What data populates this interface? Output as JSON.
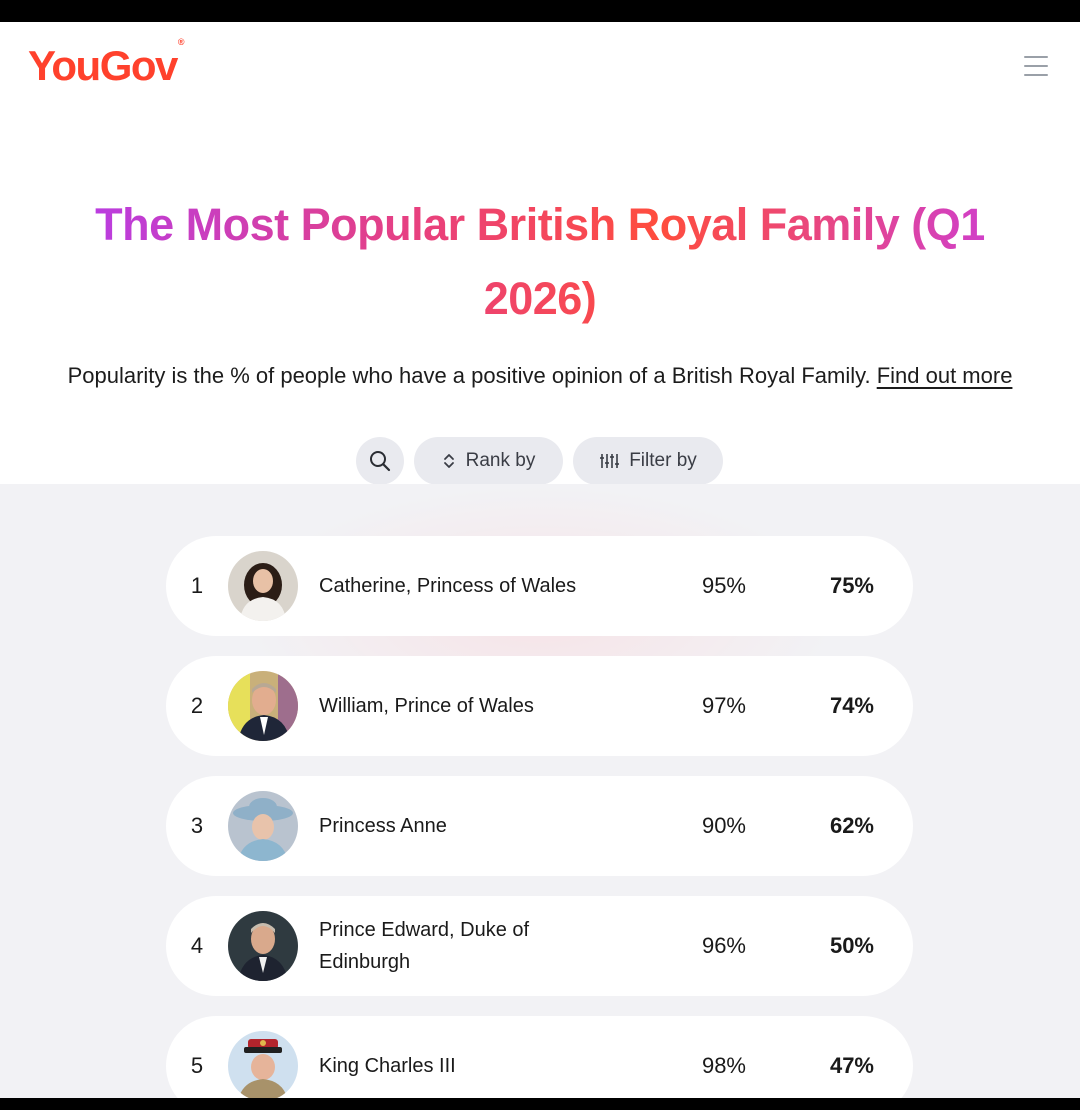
{
  "header": {
    "logo_text": "YouGov",
    "logo_mark": "®",
    "brand_color": "#ff412c",
    "menu_icon": "hamburger-menu-icon"
  },
  "title": "The Most Popular British Royal Family (Q1 2026)",
  "subtitle": {
    "text": "Popularity is the % of people who have a positive opinion of a British Royal Family.",
    "link": "Find out more"
  },
  "controls": {
    "search_icon": "search-icon",
    "rank_by": "Rank by",
    "filter_by": "Filter by"
  },
  "rankings": [
    {
      "rank": "1",
      "name": "Catherine, Princess of Wales",
      "fame": "95%",
      "popularity": "75%"
    },
    {
      "rank": "2",
      "name": "William, Prince of Wales",
      "fame": "97%",
      "popularity": "74%"
    },
    {
      "rank": "3",
      "name": "Princess Anne",
      "fame": "90%",
      "popularity": "62%"
    },
    {
      "rank": "4",
      "name": "Prince Edward, Duke of Edinburgh",
      "fame": "96%",
      "popularity": "50%"
    },
    {
      "rank": "5",
      "name": "King Charles III",
      "fame": "98%",
      "popularity": "47%"
    }
  ]
}
